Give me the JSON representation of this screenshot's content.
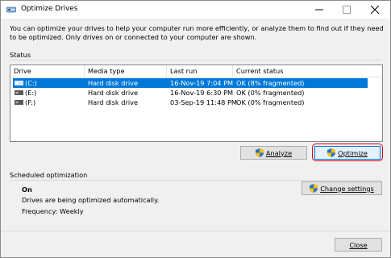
{
  "window": {
    "title": "Optimize Drives",
    "icon": "defrag-icon"
  },
  "intro": "You can optimize your drives to help your computer run more efficiently, or analyze them to find out if they need to be optimized. Only drives on or connected to your computer are shown.",
  "status": {
    "label": "Status",
    "columns": [
      "Drive",
      "Media type",
      "Last run",
      "Current status"
    ],
    "rows": [
      {
        "drive": "(C:)",
        "media": "Hard disk drive",
        "last_run": "16-Nov-19 7:04 PM",
        "status": "OK (8% fragmented)",
        "selected": true
      },
      {
        "drive": "(E:)",
        "media": "Hard disk drive",
        "last_run": "16-Nov-19 6:30 PM",
        "status": "OK (0% fragmented)",
        "selected": false
      },
      {
        "drive": "(F:)",
        "media": "Hard disk drive",
        "last_run": "03-Sep-19 11:48 PM",
        "status": "OK (0% fragmented)",
        "selected": false
      }
    ]
  },
  "buttons": {
    "analyze": "Analyze",
    "optimize": "Optimize",
    "change_settings": "Change settings",
    "close": "Close"
  },
  "scheduled": {
    "label": "Scheduled optimization",
    "state": "On",
    "description": "Drives are being optimized automatically.",
    "frequency": "Frequency: Weekly"
  },
  "colors": {
    "selection": "#0078d7",
    "highlight_ring": "#d0021b"
  }
}
